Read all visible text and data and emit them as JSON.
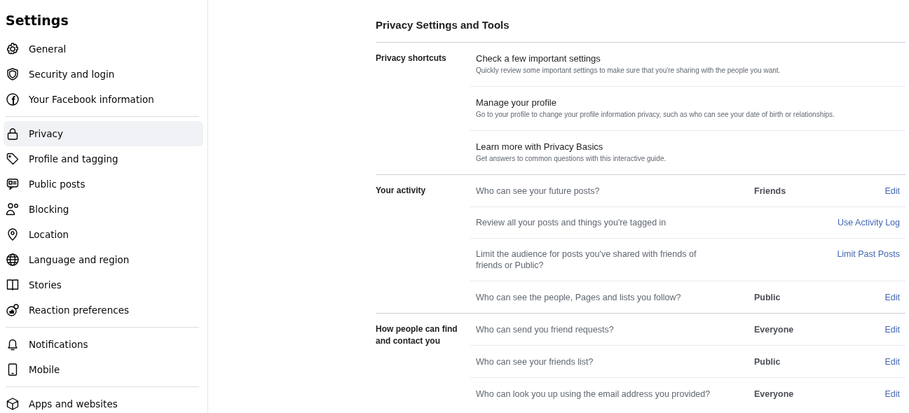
{
  "sidebar": {
    "title": "Settings",
    "groups": [
      [
        {
          "label": "General",
          "selected": false
        },
        {
          "label": "Security and login",
          "selected": false
        },
        {
          "label": "Your Facebook information",
          "selected": false
        }
      ],
      [
        {
          "label": "Privacy",
          "selected": true
        },
        {
          "label": "Profile and tagging",
          "selected": false
        },
        {
          "label": "Public posts",
          "selected": false
        },
        {
          "label": "Blocking",
          "selected": false
        },
        {
          "label": "Location",
          "selected": false
        },
        {
          "label": "Language and region",
          "selected": false
        },
        {
          "label": "Stories",
          "selected": false
        },
        {
          "label": "Reaction preferences",
          "selected": false
        }
      ],
      [
        {
          "label": "Notifications",
          "selected": false
        },
        {
          "label": "Mobile",
          "selected": false
        }
      ],
      [
        {
          "label": "Apps and websites",
          "selected": false
        }
      ]
    ]
  },
  "main": {
    "title": "Privacy Settings and Tools",
    "sections": [
      {
        "label": "Privacy shortcuts",
        "rows": [
          {
            "kind": "shortcut",
            "title": "Check a few important settings",
            "description": "Quickly review some important settings to make sure that you're sharing with the people you want."
          },
          {
            "kind": "shortcut",
            "title": "Manage your profile",
            "description": "Go to your profile to change your profile information privacy, such as who can see your date of birth or relationships."
          },
          {
            "kind": "shortcut",
            "title": "Learn more with Privacy Basics",
            "description": "Get answers to common questions with this interactive guide."
          }
        ]
      },
      {
        "label": "Your activity",
        "rows": [
          {
            "kind": "setting",
            "question": "Who can see your future posts?",
            "value": "Friends",
            "action": "Edit"
          },
          {
            "kind": "setting",
            "question": "Review all your posts and things you're tagged in",
            "action": "Use Activity Log"
          },
          {
            "kind": "setting",
            "question": "Limit the audience for posts you've shared with friends of friends or Public?",
            "action": "Limit Past Posts"
          },
          {
            "kind": "setting",
            "question": "Who can see the people, Pages and lists you follow?",
            "value": "Public",
            "action": "Edit"
          }
        ]
      },
      {
        "label": "How people can find and contact you",
        "rows": [
          {
            "kind": "setting",
            "question": "Who can send you friend requests?",
            "value": "Everyone",
            "action": "Edit"
          },
          {
            "kind": "setting",
            "question": "Who can see your friends list?",
            "value": "Public",
            "action": "Edit"
          },
          {
            "kind": "setting",
            "question": "Who can look you up using the email address you provided?",
            "value": "Everyone",
            "action": "Edit"
          }
        ]
      }
    ]
  }
}
